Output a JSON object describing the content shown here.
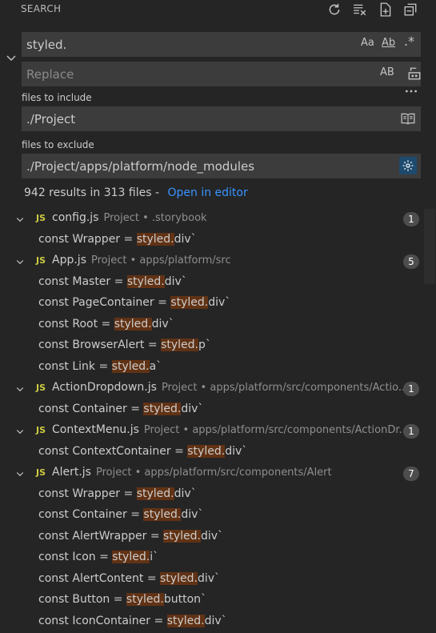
{
  "header": {
    "title": "SEARCH"
  },
  "search": {
    "query": "styled.",
    "match_case": "Aa",
    "whole_word": "Ab",
    "regex": ".*",
    "replace_placeholder": "Replace",
    "replace_all": "AB"
  },
  "include": {
    "label": "files to include",
    "value": "./Project"
  },
  "exclude": {
    "label": "files to exclude",
    "value": "./Project/apps/platform/node_modules"
  },
  "summary": {
    "text": "942 results in 313 files - ",
    "link": "Open in editor"
  },
  "results": [
    {
      "name": "config.js",
      "path": "Project • .storybook",
      "count": "1",
      "matches": [
        {
          "pre": "const Wrapper = ",
          "hit": "styled.",
          "post": "div`"
        }
      ]
    },
    {
      "name": "App.js",
      "path": "Project • apps/platform/src",
      "count": "5",
      "matches": [
        {
          "pre": "const Master = ",
          "hit": "styled.",
          "post": "div`"
        },
        {
          "pre": "const PageContainer = ",
          "hit": "styled.",
          "post": "div`"
        },
        {
          "pre": "const Root = ",
          "hit": "styled.",
          "post": "div`"
        },
        {
          "pre": "const BrowserAlert = ",
          "hit": "styled.",
          "post": "p`"
        },
        {
          "pre": "const Link = ",
          "hit": "styled.",
          "post": "a`"
        }
      ]
    },
    {
      "name": "ActionDropdown.js",
      "path": "Project • apps/platform/src/components/Actio...",
      "count": "1",
      "matches": [
        {
          "pre": "const Container = ",
          "hit": "styled.",
          "post": "div`"
        }
      ]
    },
    {
      "name": "ContextMenu.js",
      "path": "Project • apps/platform/src/components/ActionDr...",
      "count": "1",
      "matches": [
        {
          "pre": "const ContextContainer = ",
          "hit": "styled.",
          "post": "div`"
        }
      ]
    },
    {
      "name": "Alert.js",
      "path": "Project • apps/platform/src/components/Alert",
      "count": "7",
      "matches": [
        {
          "pre": "const Wrapper = ",
          "hit": "styled.",
          "post": "div`"
        },
        {
          "pre": "const Container = ",
          "hit": "styled.",
          "post": "div`"
        },
        {
          "pre": "const AlertWrapper = ",
          "hit": "styled.",
          "post": "div`"
        },
        {
          "pre": "const Icon = ",
          "hit": "styled.",
          "post": "i`"
        },
        {
          "pre": "const AlertContent = ",
          "hit": "styled.",
          "post": "div`"
        },
        {
          "pre": "const Button = ",
          "hit": "styled.",
          "post": "button`"
        },
        {
          "pre": "const IconContainer = ",
          "hit": "styled.",
          "post": "div`"
        }
      ]
    }
  ],
  "file_icon_label": "JS",
  "colors": {
    "background": "#252526",
    "input": "#3c3c3c",
    "highlight": "#613214",
    "link": "#3794ff",
    "js": "#cbcb41",
    "badge": "#4d4d4d"
  },
  "icons": [
    "refresh-icon",
    "clear-results-icon",
    "new-search-editor-icon",
    "collapse-all-icon",
    "chevron-down-icon",
    "replace-all-icon",
    "more-icon",
    "book-icon",
    "gear-icon"
  ]
}
